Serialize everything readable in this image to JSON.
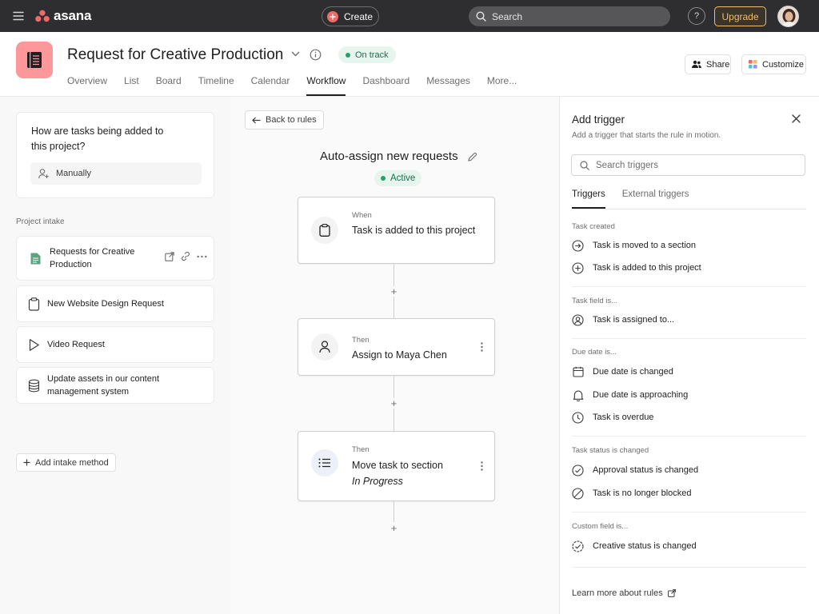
{
  "topbar": {
    "logo_text": "asana",
    "create_label": "Create",
    "search_label": "Search",
    "help_label": "?",
    "upgrade_label": "Upgrade"
  },
  "project": {
    "title": "Request for Creative Production",
    "status": "On track",
    "tabs": [
      "Overview",
      "List",
      "Board",
      "Timeline",
      "Calendar",
      "Workflow",
      "Dashboard",
      "Messages",
      "More..."
    ],
    "active_tab": "Workflow",
    "share_label": "Share",
    "customize_label": "Customize"
  },
  "left": {
    "question": "How are tasks being added to this project?",
    "manual_label": "Manually",
    "section_label": "Project intake",
    "items": [
      {
        "label": "Requests for Creative Production",
        "icon": "form-icon"
      },
      {
        "label": "New Website Design Request",
        "icon": "clipboard-icon"
      },
      {
        "label": "Video Request",
        "icon": "play-icon"
      },
      {
        "label": "Update assets in our content management system",
        "icon": "database-icon"
      }
    ],
    "add_intake_label": "Add intake method"
  },
  "center": {
    "back_label": "Back to rules",
    "rule_title": "Auto-assign new requests",
    "rule_status": "Active",
    "steps": [
      {
        "kind": "When",
        "text": "Task is added to this project",
        "text_italic": ""
      },
      {
        "kind": "Then",
        "text": "Assign to Maya Chen",
        "text_italic": ""
      },
      {
        "kind": "Then",
        "text": "Move task to section",
        "text_italic": "In Progress"
      }
    ],
    "plus_label": "+"
  },
  "right": {
    "title": "Add trigger",
    "subtitle": "Add a trigger that starts the rule in motion.",
    "search_placeholder": "Search triggers",
    "tabs": [
      "Triggers",
      "External triggers"
    ],
    "active_tab": "Triggers",
    "groups": [
      {
        "label": "Task created",
        "items": [
          "Task is moved to a section",
          "Task is added to this project"
        ]
      },
      {
        "label": "Task field is...",
        "items": [
          "Task is assigned to..."
        ]
      },
      {
        "label": "Due date is...",
        "items": [
          "Due date is changed",
          "Due date is approaching",
          "Task is overdue"
        ]
      },
      {
        "label": "Task status is changed",
        "items": [
          "Approval status is changed",
          "Task is no longer blocked"
        ]
      },
      {
        "label": "Custom field is...",
        "items": [
          "Creative status is changed"
        ]
      }
    ],
    "learn_more": "Learn more about rules"
  },
  "colors": {
    "topbar": "#2e2e30",
    "brand": "#f06a6a",
    "project_icon": "#fc979a",
    "status_green": "#2a9d6b",
    "upgrade": "#f1bd6c"
  }
}
